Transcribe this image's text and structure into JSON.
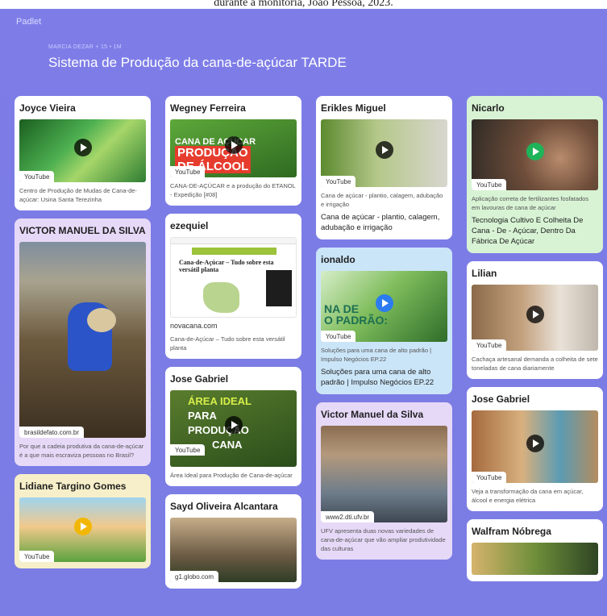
{
  "caption": "durante a monitoria, João Pessoa, 2023.",
  "header": {
    "brand": "Padlet",
    "meta": "MARCIA DEZAR + 15 • 1M",
    "title": "Sistema de Produção da cana-de-açúcar TARDE"
  },
  "posts": {
    "joyce": {
      "author": "Joyce Vieira",
      "source": "YouTube",
      "desc": "Centro de Produção de Mudas de Cana-de-açúcar: Usina Santa Terezinha"
    },
    "victor": {
      "author": "VICTOR MANUEL DA SILVA",
      "source": "brasildefato.com.br",
      "desc": "Por que a cadeia produtiva da cana-de-açúcar é a que mais escraviza pessoas no Brasil?"
    },
    "lidiane": {
      "author": "Lidiane Targino Gomes",
      "source": "YouTube"
    },
    "wegney": {
      "author": "Wegney Ferreira",
      "source": "YouTube",
      "thumb_line1": "CANA DE AÇÚCAR",
      "thumb_line2": "PRODUÇÃO",
      "thumb_line3": "DE ÁLCOOL",
      "desc": "CANA-DE-AÇÚCAR e a produção do ETANOL - Expedição [#08]"
    },
    "ezequiel": {
      "author": "ezequiel",
      "source": "novacana.com",
      "thumb_heading": "Cana-de-Açúcar – Tudo sobre esta versátil planta",
      "desc": "Cana-de-Açúcar – Tudo sobre esta versátil planta"
    },
    "josegabriel1": {
      "author": "Jose Gabriel",
      "source": "YouTube",
      "thumb_line1": "ÁREA IDEAL",
      "thumb_line2": "PARA",
      "thumb_line3": "PRODUÇÃO",
      "thumb_line4": "CANA",
      "desc": "Área Ideal para Produção de Cana-de-açúcar"
    },
    "sayd": {
      "author": "Sayd Oliveira Alcantara",
      "source": "g1.globo.com"
    },
    "erikles": {
      "author": "Erikles Miguel",
      "source": "YouTube",
      "desc": "Cana de açúcar - plantio, calagem, adubação e irrigação",
      "desc2": "Cana de açúcar - plantio, calagem, adubação e irrigação"
    },
    "ionaldo": {
      "author": "ionaldo",
      "source": "YouTube",
      "thumb_line1": "NA DE",
      "thumb_line2": "O PADRÃO:",
      "desc": "Soluções para uma cana de alto padrão | Impulso Negócios EP.22",
      "desc2": "Soluções para uma cana de alto padrão | Impulso Negócios EP.22"
    },
    "victormanuel": {
      "author": "Victor Manuel da Silva",
      "source": "www2.dti.ufv.br",
      "desc": "UFV apresenta duas novas variedades de cana-de-açúcar que vão ampliar produtividade das culturas"
    },
    "nicarlo": {
      "author": "Nicarlo",
      "source": "YouTube",
      "desc": "Aplicação correta de fertilizantes fosfatados em lavouras de cana de açúcar",
      "desc2": "Tecnologia Cultivo E Colheita De Cana - De - Açúcar, Dentro Da Fábrica De Açúcar"
    },
    "lilian": {
      "author": "Lilian",
      "source": "YouTube",
      "desc": "Cachaça artesanal demanda a colheita de sete toneladas de cana diariamente"
    },
    "josegabriel2": {
      "author": "Jose Gabriel",
      "source": "YouTube",
      "desc": "Veja a transformação da cana em açúcar, álcool e energia elétrica"
    },
    "walfram": {
      "author": "Walfram Nóbrega"
    }
  }
}
